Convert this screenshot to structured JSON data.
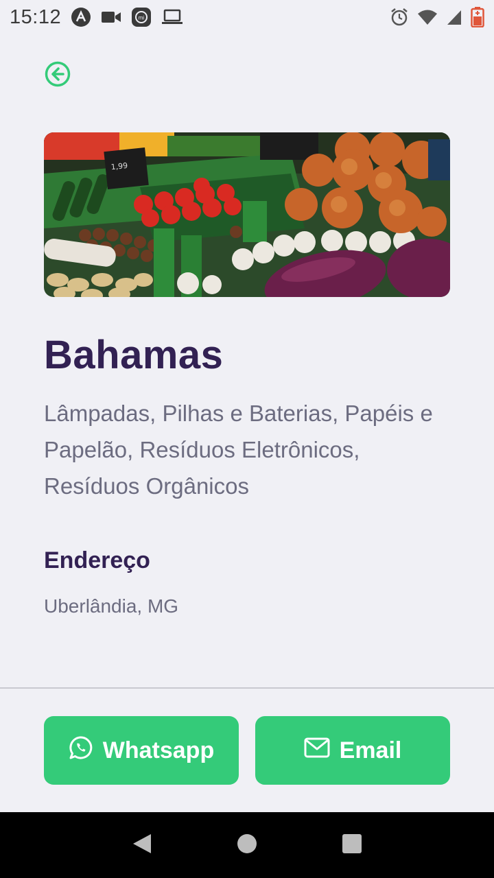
{
  "status_bar": {
    "time": "15:12",
    "left_icons": [
      "app-a-icon",
      "video-camera-icon",
      "mi-icon",
      "laptop-icon"
    ],
    "right_icons": [
      "alarm-icon",
      "wifi-icon",
      "signal-icon",
      "battery-icon"
    ]
  },
  "point": {
    "title": "Bahamas",
    "items": "Lâmpadas, Pilhas e Baterias, Papéis e Papelão, Resíduos Eletrônicos, Resíduos Orgânicos",
    "address_title": "Endereço",
    "address_value": "Uberlândia, MG",
    "image": "vegetable-market-photo"
  },
  "footer": {
    "whatsapp_label": "Whatsapp",
    "email_label": "Email"
  },
  "colors": {
    "accent": "#34cb79",
    "title": "#322153",
    "text": "#6c6c80",
    "background": "#f0f0f5"
  }
}
